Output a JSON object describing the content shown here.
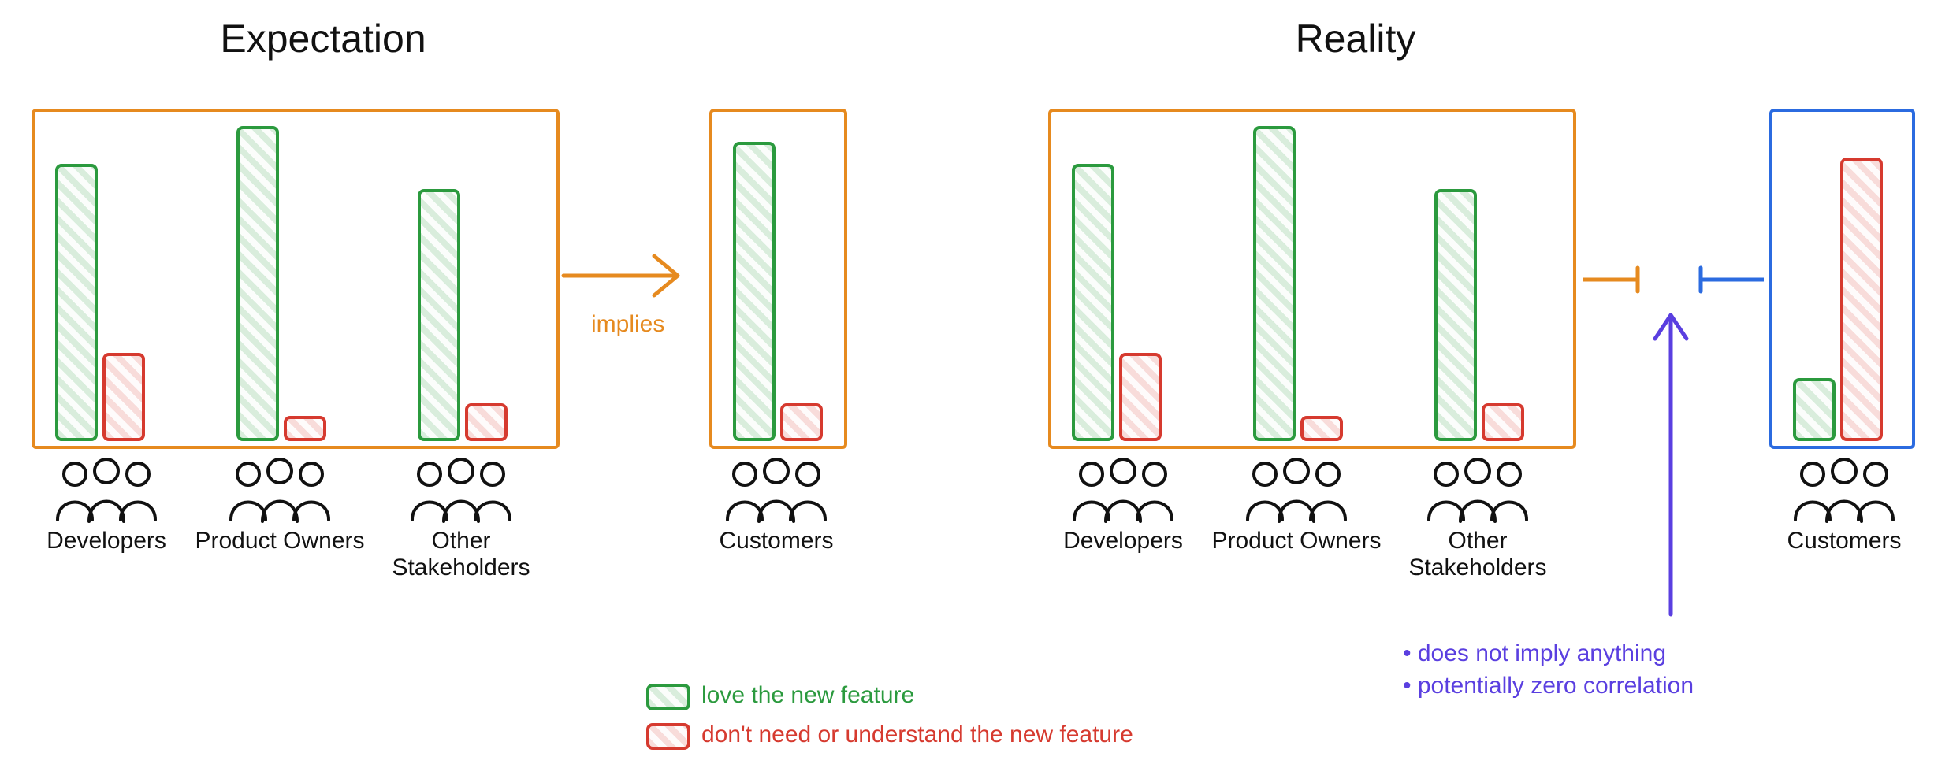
{
  "colors": {
    "orange": "#e68a1f",
    "blue": "#2b6be0",
    "green": "#2b9a3e",
    "red": "#d63a2f",
    "purple": "#5a3fe0",
    "ink": "#111111"
  },
  "titles": {
    "expectation": "Expectation",
    "reality": "Reality"
  },
  "labels": {
    "implies": "implies",
    "developers": "Developers",
    "product_owners": "Product Owners",
    "other_stakeholders": "Other\nStakeholders",
    "customers": "Customers"
  },
  "legend": {
    "love": "love the new feature",
    "dont_need": "don't need or understand the new feature"
  },
  "annotation": {
    "line1": "• does not imply anything",
    "line2": "• potentially zero correlation"
  },
  "chart_data": [
    {
      "panel": "Expectation",
      "type": "bar",
      "ylabel": "",
      "xlabel": "",
      "ylim": [
        0,
        100
      ],
      "categories": [
        "Developers",
        "Product Owners",
        "Other Stakeholders",
        "Customers"
      ],
      "series": [
        {
          "name": "love the new feature",
          "values": [
            88,
            100,
            80,
            95
          ]
        },
        {
          "name": "don't need or understand the new feature",
          "values": [
            28,
            8,
            12,
            12
          ]
        }
      ],
      "implication": {
        "from": [
          "Developers",
          "Product Owners",
          "Other Stakeholders"
        ],
        "to": "Customers",
        "label": "implies"
      }
    },
    {
      "panel": "Reality",
      "type": "bar",
      "ylabel": "",
      "xlabel": "",
      "ylim": [
        0,
        100
      ],
      "categories": [
        "Developers",
        "Product Owners",
        "Other Stakeholders",
        "Customers"
      ],
      "series": [
        {
          "name": "love the new feature",
          "values": [
            88,
            100,
            80,
            20
          ]
        },
        {
          "name": "don't need or understand the new feature",
          "values": [
            28,
            8,
            12,
            90
          ]
        }
      ],
      "implication": {
        "from": [
          "Developers",
          "Product Owners",
          "Other Stakeholders"
        ],
        "to": "Customers",
        "label": "does not imply anything; potentially zero correlation"
      }
    }
  ]
}
